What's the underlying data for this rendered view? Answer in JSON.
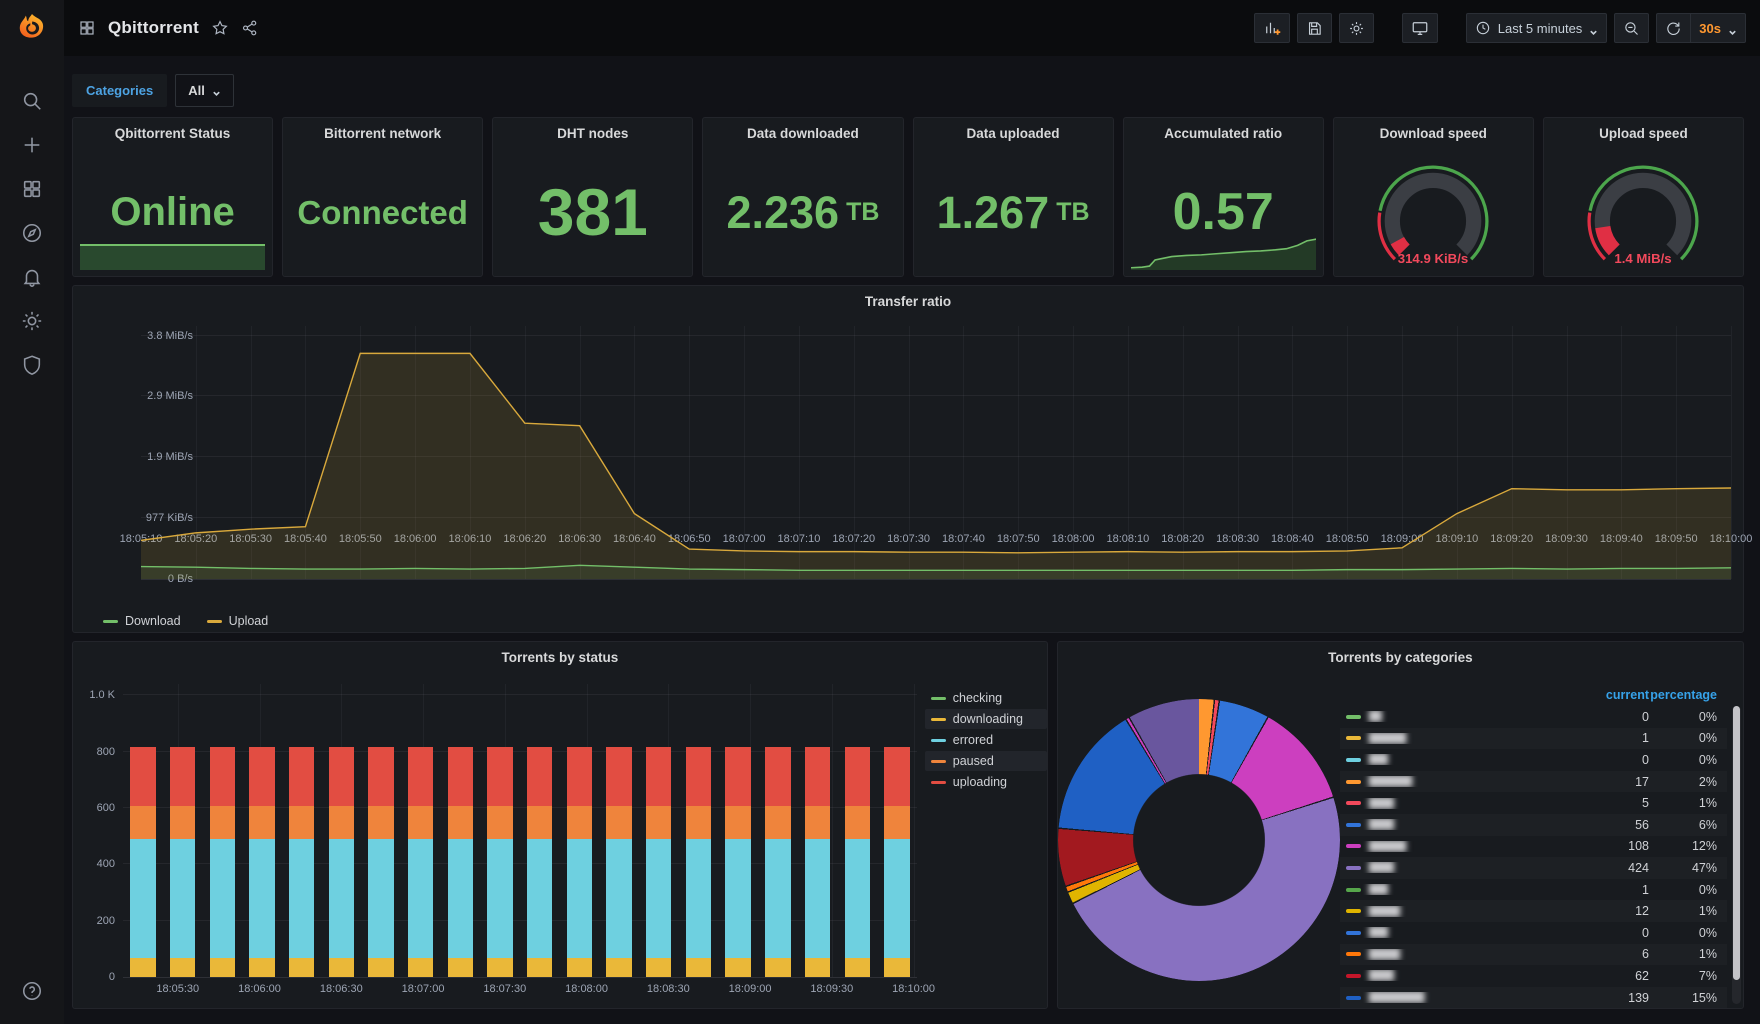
{
  "sidebar": {
    "icons": [
      "grafana-logo",
      "search",
      "plus",
      "dashboards",
      "explore",
      "alerting",
      "settings",
      "shield",
      "help"
    ]
  },
  "header": {
    "title": "Qbittorrent"
  },
  "toolbar": {
    "buttons": [
      "add-panel",
      "save",
      "dashboard-settings",
      "tv-mode"
    ],
    "time_range": "Last 5 minutes",
    "refresh_interval": "30s"
  },
  "filters": {
    "label": "Categories",
    "value": "All"
  },
  "accent": {
    "green": "#73bf69",
    "red": "#f2495c",
    "blue": "#36a2e9",
    "orange": "#ff9830"
  },
  "stats": [
    {
      "title": "Qbittorrent Status",
      "value": "Online",
      "type": "text-sparkbar",
      "size": 40
    },
    {
      "title": "Bittorrent network",
      "value": "Connected",
      "type": "text",
      "size": 33
    },
    {
      "title": "DHT nodes",
      "value": "381",
      "type": "text",
      "size": 66
    },
    {
      "title": "Data downloaded",
      "value": "2.236",
      "unit": "TB",
      "type": "text-unit",
      "size": 45
    },
    {
      "title": "Data uploaded",
      "value": "1.267",
      "unit": "TB",
      "type": "text-unit",
      "size": 45
    },
    {
      "title": "Accumulated ratio",
      "value": "0.57",
      "type": "text-sparkline",
      "size": 52,
      "sparkline": [
        [
          0,
          0.04
        ],
        [
          0.06,
          0.05
        ],
        [
          0.1,
          0.07
        ],
        [
          0.13,
          0.18
        ],
        [
          0.16,
          0.2
        ],
        [
          0.22,
          0.24
        ],
        [
          0.3,
          0.26
        ],
        [
          0.38,
          0.27
        ],
        [
          0.46,
          0.29
        ],
        [
          0.54,
          0.31
        ],
        [
          0.62,
          0.33
        ],
        [
          0.7,
          0.34
        ],
        [
          0.78,
          0.36
        ],
        [
          0.84,
          0.38
        ],
        [
          0.9,
          0.44
        ],
        [
          0.95,
          0.52
        ],
        [
          1,
          0.55
        ]
      ]
    },
    {
      "title": "Download speed",
      "value": "314.9 KiB/s",
      "type": "gauge",
      "fraction": 0.06,
      "threshold_red_end": 0.2
    },
    {
      "title": "Upload speed",
      "value": "1.4 MiB/s",
      "type": "gauge",
      "fraction": 0.135,
      "threshold_red_end": 0.2
    }
  ],
  "chart_data": [
    {
      "id": "transfer",
      "type": "area",
      "title": "Transfer ratio",
      "ylabels": [
        "3.8 MiB/s",
        "2.9 MiB/s",
        "1.9 MiB/s",
        "977 KiB/s",
        "0 B/s"
      ],
      "ymax_mibs": 4.06,
      "grid_values_mibs": [
        0.977,
        1.953,
        2.93,
        3.906
      ],
      "x": [
        "18:05:10",
        "18:05:20",
        "18:05:30",
        "18:05:40",
        "18:05:50",
        "18:06:00",
        "18:06:10",
        "18:06:20",
        "18:06:30",
        "18:06:40",
        "18:06:50",
        "18:07:00",
        "18:07:10",
        "18:07:20",
        "18:07:30",
        "18:07:40",
        "18:07:50",
        "18:08:00",
        "18:08:10",
        "18:08:20",
        "18:08:30",
        "18:08:40",
        "18:08:50",
        "18:09:00",
        "18:09:10",
        "18:09:20",
        "18:09:30",
        "18:09:40",
        "18:09:50",
        "18:10:00"
      ],
      "series": [
        {
          "name": "Download",
          "color": "#73bf69",
          "fill": "rgba(115,191,105,0.10)",
          "values": [
            0.2,
            0.19,
            0.17,
            0.16,
            0.16,
            0.17,
            0.16,
            0.17,
            0.22,
            0.19,
            0.16,
            0.15,
            0.14,
            0.14,
            0.14,
            0.14,
            0.14,
            0.14,
            0.14,
            0.14,
            0.14,
            0.14,
            0.15,
            0.15,
            0.16,
            0.17,
            0.16,
            0.17,
            0.17,
            0.18
          ]
        },
        {
          "name": "Upload",
          "color": "#d9a93c",
          "fill": "rgba(216,169,56,0.14)",
          "values": [
            0.62,
            0.74,
            0.8,
            0.84,
            3.62,
            3.62,
            3.62,
            2.5,
            2.46,
            1.05,
            0.48,
            0.45,
            0.44,
            0.44,
            0.43,
            0.43,
            0.42,
            0.43,
            0.44,
            0.43,
            0.44,
            0.44,
            0.45,
            0.5,
            1.05,
            1.45,
            1.43,
            1.43,
            1.45,
            1.46
          ]
        }
      ],
      "legend_position": "bottom"
    },
    {
      "id": "status",
      "type": "bar",
      "stacked": true,
      "title": "Torrents by status",
      "ylabels": [
        "1.0 K",
        "800",
        "600",
        "400",
        "200",
        "0"
      ],
      "grid_values": [
        200,
        400,
        600,
        800,
        1000
      ],
      "ymax": 1040,
      "bar_count": 20,
      "x_ticks": [
        "18:05:30",
        "18:06:00",
        "18:06:30",
        "18:07:00",
        "18:07:30",
        "18:08:00",
        "18:08:30",
        "18:09:00",
        "18:09:30",
        "18:10:00"
      ],
      "x_tick_start_pct": 6.9,
      "x_tick_step_pct": 10.3,
      "series": [
        {
          "name": "checking",
          "color": "#73bf69",
          "value": 0
        },
        {
          "name": "downloading",
          "color": "#eab839",
          "value": 75
        },
        {
          "name": "errored",
          "color": "#6ed0e0",
          "value": 465
        },
        {
          "name": "paused",
          "color": "#ef843c",
          "value": 130
        },
        {
          "name": "uploading",
          "color": "#e24d42",
          "value": 230
        }
      ],
      "legend_position": "right",
      "legend_striped_indices": [
        1,
        3
      ]
    },
    {
      "id": "categories",
      "type": "pie",
      "donut": true,
      "title": "Torrents by categories",
      "start_angle_deg": -7,
      "slices": [
        {
          "color": "#c8f2c2",
          "deg": 6.5
        },
        {
          "color": "#ff9830",
          "deg": 6.5
        },
        {
          "color": "#f2495c",
          "deg": 2
        },
        {
          "color": "#3274d9",
          "deg": 21
        },
        {
          "color": "#cc3fbf",
          "deg": 43
        },
        {
          "color": "#8871c1",
          "deg": 171
        },
        {
          "color": "#e0b400",
          "deg": 5
        },
        {
          "color": "#ff780a",
          "deg": 2.5
        },
        {
          "color": "#a2191f",
          "deg": 24
        },
        {
          "color": "#1f60c4",
          "deg": 54
        },
        {
          "color": "#cc3fbf",
          "deg": 1.5
        },
        {
          "color": "#69569e",
          "deg": 23
        }
      ],
      "table": {
        "columns": [
          "current",
          "percentage"
        ],
        "labels_blurred": true,
        "rows": [
          {
            "color": "#73bf69",
            "label": "██",
            "current": "0",
            "percentage": "0%"
          },
          {
            "color": "#eab839",
            "label": "██████",
            "current": "1",
            "percentage": "0%"
          },
          {
            "color": "#6ed0e0",
            "label": "███",
            "current": "0",
            "percentage": "0%"
          },
          {
            "color": "#ff9830",
            "label": "███████",
            "current": "17",
            "percentage": "2%"
          },
          {
            "color": "#f2495c",
            "label": "████",
            "current": "5",
            "percentage": "1%"
          },
          {
            "color": "#3274d9",
            "label": "████",
            "current": "56",
            "percentage": "6%"
          },
          {
            "color": "#cc3fbf",
            "label": "██████",
            "current": "108",
            "percentage": "12%"
          },
          {
            "color": "#8871c1",
            "label": "████",
            "current": "424",
            "percentage": "47%"
          },
          {
            "color": "#56a64b",
            "label": "███",
            "current": "1",
            "percentage": "0%"
          },
          {
            "color": "#e0b400",
            "label": "█████",
            "current": "12",
            "percentage": "1%"
          },
          {
            "color": "#3274d9",
            "label": "███",
            "current": "0",
            "percentage": "0%"
          },
          {
            "color": "#ff780a",
            "label": "█████",
            "current": "6",
            "percentage": "1%"
          },
          {
            "color": "#c4162a",
            "label": "████",
            "current": "62",
            "percentage": "7%"
          },
          {
            "color": "#1f60c4",
            "label": "█████████",
            "current": "139",
            "percentage": "15%"
          }
        ]
      }
    }
  ]
}
